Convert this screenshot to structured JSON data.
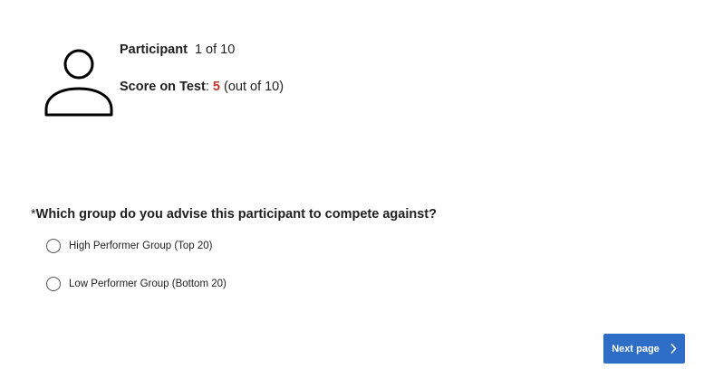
{
  "participant": {
    "label": "Participant",
    "value": "1 of 10"
  },
  "score": {
    "label": "Score on Test",
    "separator": ":",
    "value": "5",
    "suffix": "(out of 10)",
    "value_color": "#c0392b"
  },
  "question": {
    "required_marker": "*",
    "text": "Which group do you advise this participant to compete against?",
    "options": [
      {
        "label": "High Performer Group (Top 20)",
        "selected": false
      },
      {
        "label": "Low Performer Group (Bottom 20)",
        "selected": false
      }
    ]
  },
  "navigation": {
    "next_label": "Next page",
    "next_icon": "chevron-right-icon",
    "button_color": "#2f6ec7"
  },
  "avatar": {
    "icon": "user-icon"
  }
}
